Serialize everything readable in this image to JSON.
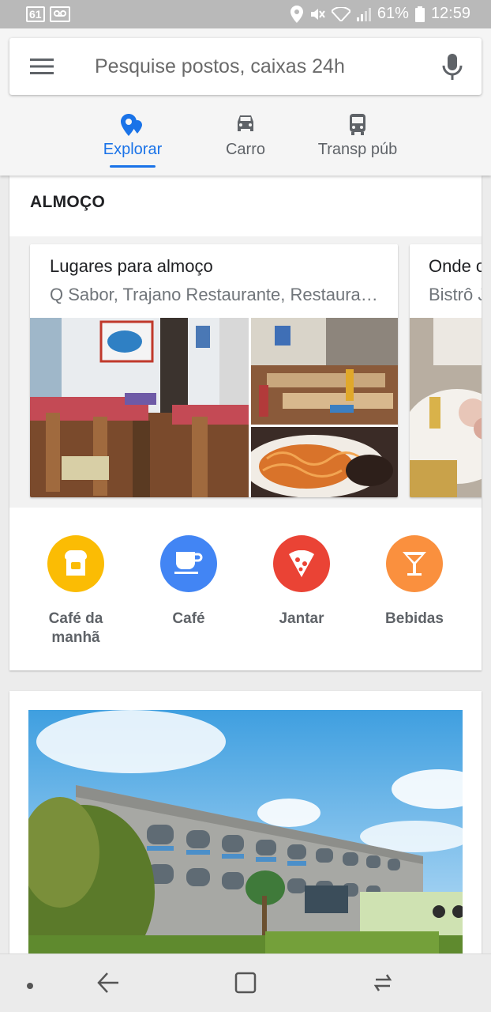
{
  "status_bar": {
    "left_badges": [
      "61",
      "✉"
    ],
    "battery": "61%",
    "time": "12:59"
  },
  "search": {
    "placeholder": "Pesquise postos, caixas 24h"
  },
  "tabs": [
    {
      "label": "Explorar",
      "icon": "place-icon",
      "active": true
    },
    {
      "label": "Carro",
      "icon": "car-icon",
      "active": false
    },
    {
      "label": "Transp púb",
      "icon": "bus-icon",
      "active": false
    }
  ],
  "section": {
    "title": "ALMOÇO"
  },
  "place_cards": [
    {
      "title": "Lugares para almoço",
      "subtitle": "Q Sabor, Trajano Restaurante, Restaura…"
    },
    {
      "title": "Onde os",
      "subtitle": "Bistrô J"
    }
  ],
  "categories": [
    {
      "label_line1": "Café da",
      "label_line2": "manhã",
      "icon": "toast-icon",
      "color": "#fbbc04"
    },
    {
      "label_line1": "Café",
      "label_line2": "",
      "icon": "coffee-icon",
      "color": "#4285f4"
    },
    {
      "label_line1": "Jantar",
      "label_line2": "",
      "icon": "pizza-icon",
      "color": "#ea4335"
    },
    {
      "label_line1": "Bebidas",
      "label_line2": "",
      "icon": "cocktail-icon",
      "color": "#fa903e"
    }
  ],
  "colors": {
    "accent": "#1a73e8",
    "text_secondary": "#5f6368"
  }
}
